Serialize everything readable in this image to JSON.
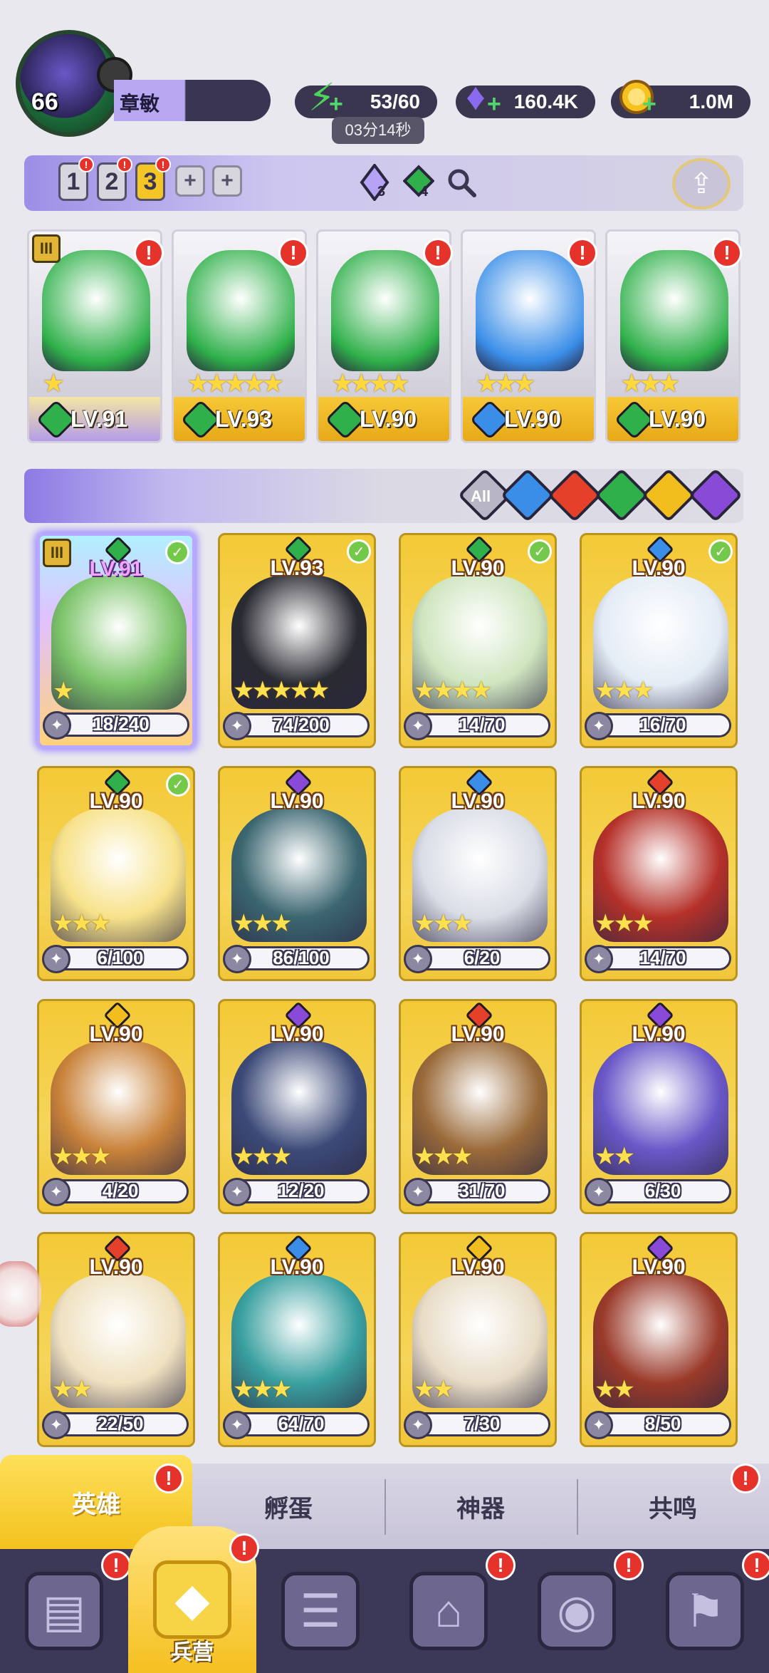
{
  "player": {
    "level": "66",
    "name": "章敏"
  },
  "resources": {
    "energy": {
      "value": "53/60",
      "timer": "03分14秒",
      "icon": "lightning-icon",
      "color": "#4fd160"
    },
    "gems": {
      "value": "160.4K",
      "icon": "diamond-icon",
      "color": "#8a6af0"
    },
    "gold": {
      "value": "1.0M",
      "icon": "coin-icon",
      "color": "#f5c21e"
    }
  },
  "team_slots": [
    {
      "label": "1",
      "active": false
    },
    {
      "label": "2",
      "active": false
    },
    {
      "label": "3",
      "active": true
    }
  ],
  "team_plus_labels": [
    "+",
    "+"
  ],
  "gem_counts": {
    "purple": "3",
    "green": "4"
  },
  "team_heroes": [
    {
      "level": "LV.91",
      "element": "nature",
      "stars": "★",
      "has_alert": true,
      "rank": "III"
    },
    {
      "level": "LV.93",
      "element": "nature",
      "stars": "★★★★★",
      "has_alert": true
    },
    {
      "level": "LV.90",
      "element": "nature",
      "stars": "★★★★",
      "has_alert": true
    },
    {
      "level": "LV.90",
      "element": "water",
      "stars": "★★★",
      "has_alert": true
    },
    {
      "level": "LV.90",
      "element": "nature",
      "stars": "★★★",
      "has_alert": true
    }
  ],
  "filter": {
    "all_label": "All",
    "elements": [
      "water",
      "fire",
      "nature",
      "light",
      "dark"
    ]
  },
  "element_colors": {
    "water": "#3a8ee8",
    "fire": "#e5402a",
    "nature": "#2fb04a",
    "light": "#f2be1e",
    "dark": "#8a4ad8"
  },
  "heroes": [
    {
      "level": "LV.91",
      "element": "nature",
      "shards": "18/240",
      "stars": "★",
      "checked": true,
      "selected": true,
      "rank": "III",
      "tint": "#7cc46a"
    },
    {
      "level": "LV.93",
      "element": "nature",
      "shards": "74/200",
      "stars": "★★★★★",
      "checked": true,
      "tint": "#2a2a32"
    },
    {
      "level": "LV.90",
      "element": "nature",
      "shards": "14/70",
      "stars": "★★★★",
      "checked": true,
      "tint": "#cfe6c0"
    },
    {
      "level": "LV.90",
      "element": "water",
      "shards": "16/70",
      "stars": "★★★",
      "checked": true,
      "tint": "#e4ecf6"
    },
    {
      "level": "LV.90",
      "element": "nature",
      "shards": "6/100",
      "stars": "★★★",
      "checked": true,
      "tint": "#f7e28a"
    },
    {
      "level": "LV.90",
      "element": "dark",
      "shards": "86/100",
      "stars": "★★★",
      "tint": "#3b6670"
    },
    {
      "level": "LV.90",
      "element": "water",
      "shards": "6/20",
      "stars": "★★★",
      "tint": "#d9dde6"
    },
    {
      "level": "LV.90",
      "element": "fire",
      "shards": "14/70",
      "stars": "★★★",
      "tint": "#b5312a"
    },
    {
      "level": "LV.90",
      "element": "light",
      "shards": "4/20",
      "stars": "★★★",
      "tint": "#c9823a"
    },
    {
      "level": "LV.90",
      "element": "dark",
      "shards": "12/20",
      "stars": "★★★",
      "tint": "#3c4a78"
    },
    {
      "level": "LV.90",
      "element": "fire",
      "shards": "31/70",
      "stars": "★★★",
      "tint": "#9a6a3a"
    },
    {
      "level": "LV.90",
      "element": "dark",
      "shards": "6/30",
      "stars": "★★",
      "tint": "#6a58c8"
    },
    {
      "level": "LV.90",
      "element": "fire",
      "shards": "22/50",
      "stars": "★★",
      "tint": "#efe1c0"
    },
    {
      "level": "LV.90",
      "element": "water",
      "shards": "64/70",
      "stars": "★★★",
      "tint": "#3aa0a0"
    },
    {
      "level": "LV.90",
      "element": "light",
      "shards": "7/30",
      "stars": "★★",
      "tint": "#e8dcc6"
    },
    {
      "level": "LV.90",
      "element": "dark",
      "shards": "8/50",
      "stars": "★★",
      "tint": "#9a3a2a"
    }
  ],
  "sub_tabs": [
    {
      "label": "英雄",
      "active": true,
      "has_alert": true
    },
    {
      "label": "孵蛋",
      "active": false,
      "has_alert": false
    },
    {
      "label": "神器",
      "active": false,
      "has_alert": false
    },
    {
      "label": "共鸣",
      "active": false,
      "has_alert": true
    }
  ],
  "bottom_nav": [
    {
      "label": "",
      "icon": "cards-icon",
      "has_alert": true,
      "active": false
    },
    {
      "label": "兵营",
      "icon": "barracks-icon",
      "has_alert": true,
      "active": true
    },
    {
      "label": "",
      "icon": "map-icon",
      "has_alert": false,
      "active": false
    },
    {
      "label": "",
      "icon": "castle-icon",
      "has_alert": true,
      "active": false
    },
    {
      "label": "",
      "icon": "guild-icon",
      "has_alert": true,
      "active": false
    },
    {
      "label": "",
      "icon": "banner-icon",
      "has_alert": true,
      "active": false
    }
  ]
}
